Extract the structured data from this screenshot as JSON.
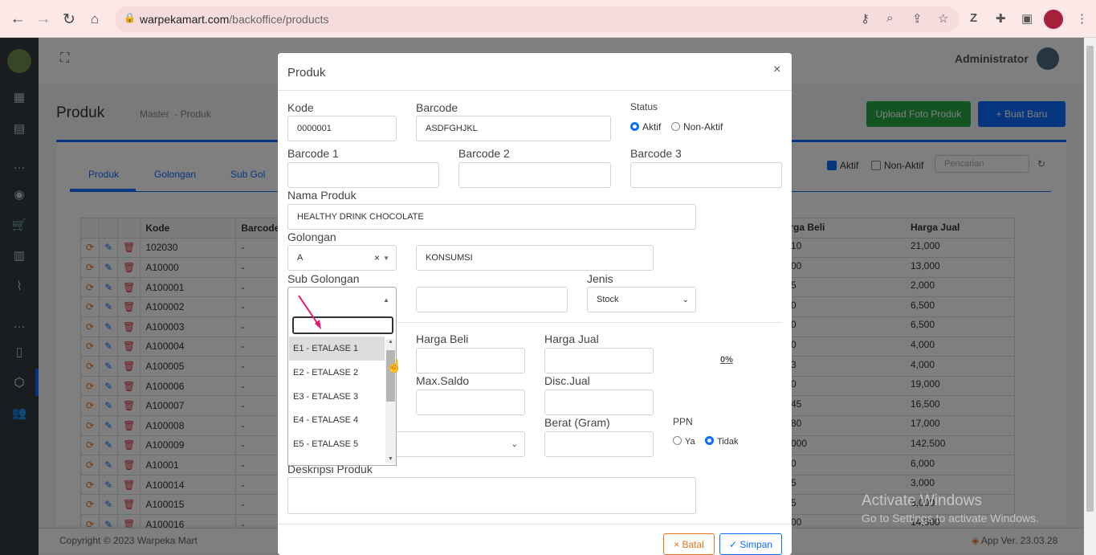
{
  "browser": {
    "url_host": "warpekamart.com",
    "url_path": "/backoffice/products"
  },
  "topbar": {
    "user": "Administrator"
  },
  "page": {
    "title": "Produk",
    "breadcrumb_1": "Master",
    "breadcrumb_sep": "-",
    "breadcrumb_2": "Produk",
    "upload_btn": "Upload Foto Produk",
    "new_btn": "+ Buat Baru",
    "tabs": [
      "Produk",
      "Golongan",
      "Sub Gol"
    ],
    "filter_aktif": "Aktif",
    "filter_nonaktif": "Non-Aktif",
    "search_placeholder": "Pencarian"
  },
  "table": {
    "headers": {
      "kode": "Kode",
      "barcode": "Barcode",
      "harga_beli": "Harga Beli",
      "harga_jual": "Harga Jual"
    },
    "rows": [
      {
        "kode": "102030",
        "barcode": "-",
        "beli": "10",
        "jual": "21,000"
      },
      {
        "kode": "A10000",
        "barcode": "-",
        "beli": "00",
        "jual": "13,000"
      },
      {
        "kode": "A100001",
        "barcode": "-",
        "beli": "5",
        "jual": "2,000"
      },
      {
        "kode": "A100002",
        "barcode": "-",
        "beli": "0",
        "jual": "6,500"
      },
      {
        "kode": "A100003",
        "barcode": "-",
        "beli": "0",
        "jual": "6,500"
      },
      {
        "kode": "A100004",
        "barcode": "-",
        "beli": "0",
        "jual": "4,000"
      },
      {
        "kode": "A100005",
        "barcode": "-",
        "beli": "3",
        "jual": "4,000"
      },
      {
        "kode": "A100006",
        "barcode": "-",
        "beli": "0",
        "jual": "19,000"
      },
      {
        "kode": "A100007",
        "barcode": "-",
        "beli": "45",
        "jual": "16,500"
      },
      {
        "kode": "A100008",
        "barcode": "-",
        "beli": "80",
        "jual": "17,000"
      },
      {
        "kode": "A100009",
        "barcode": "-",
        "beli": "000",
        "jual": "142,500"
      },
      {
        "kode": "A10001",
        "barcode": "-",
        "beli": "0",
        "jual": "6,000"
      },
      {
        "kode": "A100014",
        "barcode": "-",
        "beli": "5",
        "jual": "3,000"
      },
      {
        "kode": "A100015",
        "barcode": "-",
        "beli": "5",
        "jual": "3,000"
      },
      {
        "kode": "A100016",
        "barcode": "-",
        "beli": "00",
        "jual": "14,500"
      }
    ]
  },
  "footer": {
    "copyright": "Copyright © 2023 Warpeka Mart",
    "version": "App Ver. 23.03.28"
  },
  "modal": {
    "title": "Produk",
    "close": "×",
    "kode_label": "Kode",
    "kode_value": "0000001",
    "barcode_label": "Barcode",
    "barcode_value": "ASDFGHJKL",
    "status_label": "Status",
    "status_aktif": "Aktif",
    "status_nonaktif": "Non-Aktif",
    "barcode1_label": "Barcode 1",
    "barcode2_label": "Barcode 2",
    "barcode3_label": "Barcode 3",
    "nama_label": "Nama Produk",
    "nama_value": "HEALTHY DRINK CHOCOLATE",
    "golongan_label": "Golongan",
    "golongan_value": "A",
    "golongan_name": "KONSUMSI",
    "subgol_label": "Sub Golongan",
    "jenis_label": "Jenis",
    "jenis_value": "Stock",
    "harga_beli_label": "Harga Beli",
    "harga_jual_label": "Harga Jual",
    "percent": "0%",
    "maxsaldo_label": "Max.Saldo",
    "discjual_label": "Disc.Jual",
    "berat_label": "Berat (Gram)",
    "ppn_label": "PPN",
    "ppn_ya": "Ya",
    "ppn_tidak": "Tidak",
    "deskripsi_label": "Deskripsi Produk",
    "batal": "× Batal",
    "simpan": "✓ Simpan"
  },
  "dropdown": {
    "items": [
      "E1 - ETALASE 1",
      "E2 - ETALASE 2",
      "E3 - ETALASE 3",
      "E4 - ETALASE 4",
      "E5 - ETALASE 5"
    ]
  },
  "watermark": {
    "line1": "Activate Windows",
    "line2": "Go to Settings to activate Windows."
  },
  "colors": {
    "primary": "#0d6efd",
    "success": "#28a745",
    "danger": "#dc3545",
    "accent_arrow": "#e8176f"
  }
}
